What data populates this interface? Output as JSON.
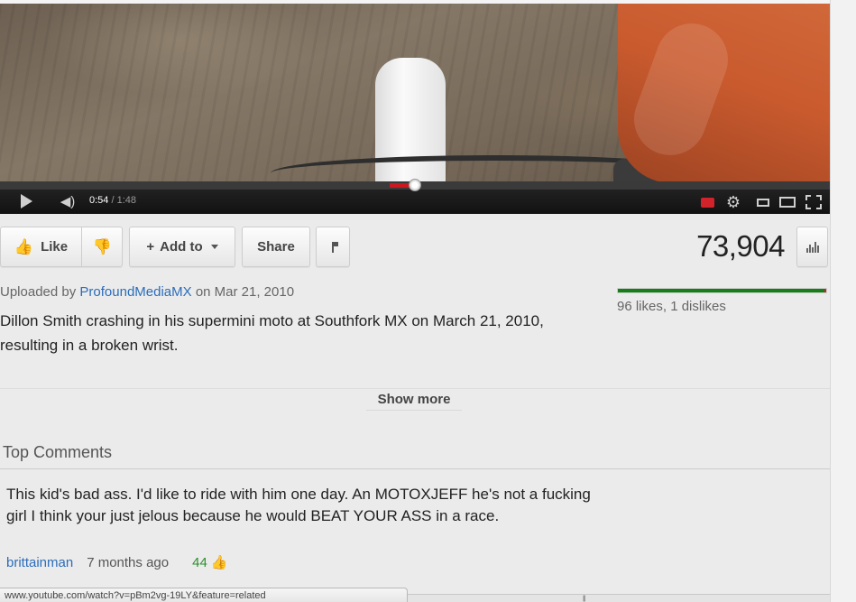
{
  "player": {
    "current_time": "0:54",
    "separator": " / ",
    "duration": "1:48",
    "progress_fraction": 0.5
  },
  "actions": {
    "like_label": "Like",
    "add_to_label": "Add to",
    "add_to_prefix": "+",
    "share_label": "Share"
  },
  "stats": {
    "view_count": "73,904",
    "likes_text": "96 likes, 1 dislikes",
    "like_fraction": 0.99
  },
  "upload": {
    "prefix": "Uploaded by",
    "uploader": "ProfoundMediaMX",
    "date_text": "on Mar 21, 2010"
  },
  "description": "Dillon Smith crashing in his supermini moto at Southfork MX on March 21, 2010, resulting in a broken wrist.",
  "show_more_label": "Show more",
  "comments": {
    "title": "Top Comments",
    "items": [
      {
        "text": "This kid's bad ass. I'd like to ride with him one day. An MOTOXJEFF he's not a fucking girl I think your just jelous because he would BEAT YOUR ASS in a race.",
        "author": "brittainman",
        "time": "7 months ago",
        "votes": "44"
      }
    ]
  },
  "status_bar": {
    "url": "www.youtube.com/watch?v=pBm2vg-19LY&feature=related"
  },
  "colors": {
    "accent_red": "#cc181e",
    "link_blue": "#2b6dbb",
    "like_green": "#157e19",
    "dislike_red": "#c62828"
  },
  "icons": [
    "play-icon",
    "volume-icon",
    "captions-icon",
    "gear-icon",
    "small-player-icon",
    "large-player-icon",
    "fullscreen-icon",
    "thumbs-up-icon",
    "thumbs-down-icon",
    "flag-icon",
    "stats-icon"
  ]
}
